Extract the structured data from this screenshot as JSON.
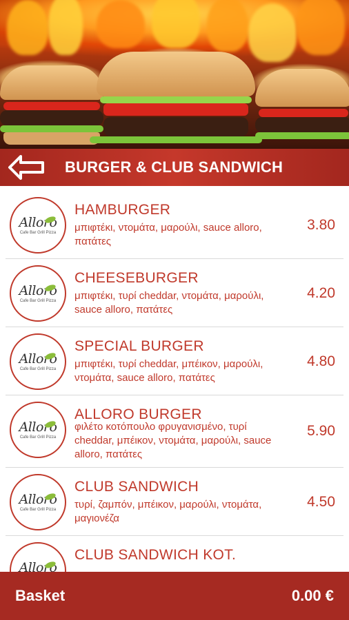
{
  "header": {
    "title": "BURGER & CLUB SANDWICH",
    "back_icon": "arrow-left-icon",
    "accent_color": "#c0392b"
  },
  "logo": {
    "word": "Alloro",
    "tagline": "Cafe Bar Grill Pizza"
  },
  "menu": {
    "items": [
      {
        "name": "HAMBURGER",
        "description": "μπιφτέκι, ντομάτα, μαρούλι, sauce alloro, πατάτες",
        "price": "3.80"
      },
      {
        "name": "CHEESEBURGER",
        "description": "μπιφτέκι, τυρί cheddar, ντομάτα, μαρούλι, sauce alloro, πατάτες",
        "price": "4.20"
      },
      {
        "name": "SPECIAL BURGER",
        "description": "μπιφτέκι, τυρί cheddar, μπέικον, μαρούλι, ντομάτα, sauce alloro, πατάτες",
        "price": "4.80"
      },
      {
        "name": "ALLORO BURGER",
        "description": "φιλέτο κοτόπουλο φρυγανισμένο, τυρί cheddar, μπέικον, ντομάτα, μαρούλι, sauce alloro, πατάτες",
        "price": "5.90"
      },
      {
        "name": "CLUB SANDWICH",
        "description": "τυρί, ζαμπόν, μπέικον, μαρούλι, ντομάτα, μαγιονέζα",
        "price": "4.50"
      },
      {
        "name": "CLUB SANDWICH KOT.",
        "description": "",
        "price": ""
      }
    ]
  },
  "basket": {
    "label": "Basket",
    "total": "0.00 €"
  }
}
